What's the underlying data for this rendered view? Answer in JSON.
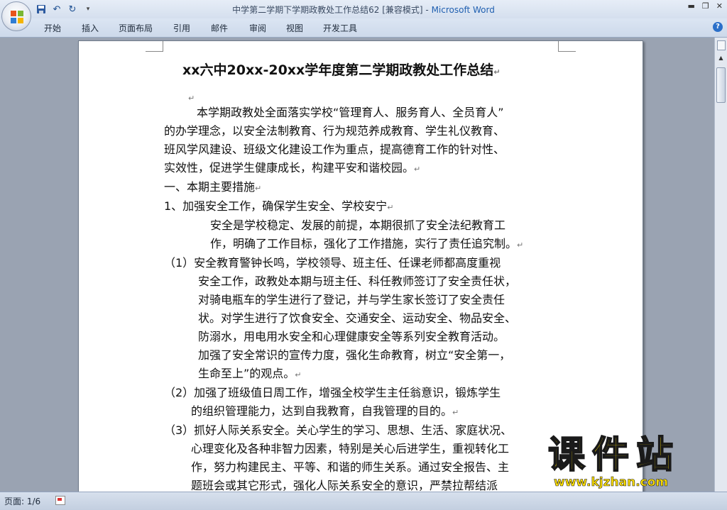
{
  "window": {
    "title": "中学第二学期下学期政教处工作总结62 [兼容模式]",
    "separator": " - ",
    "app_name": "Microsoft Word"
  },
  "ribbon_tabs": [
    "开始",
    "插入",
    "页面布局",
    "引用",
    "邮件",
    "审阅",
    "视图",
    "开发工具"
  ],
  "document": {
    "heading": "xx六中20xx-20xx学年度第二学期政教处工作总结",
    "lines": [
      "本学期政教处全面落实学校“管理育人、服务育人、全员育人”",
      "的办学理念，以安全法制教育、行为规范养成教育、学生礼仪教育、",
      "班风学风建设、班级文化建设工作为重点，提高德育工作的针对性、",
      "实效性，促进学生健康成长，构建平安和谐校园。",
      "一、本期主要措施",
      "1、加强安全工作，确保学生安全、学校安宁",
      "安全是学校稳定、发展的前提，本期很抓了安全法纪教育工",
      "作，明确了工作目标，强化了工作措施，实行了责任追究制。",
      "（1）安全教育警钟长鸣，学校领导、班主任、任课老师都高度重视",
      "安全工作，政教处本期与班主任、科任教师签订了安全责任状，",
      "对骑电瓶车的学生进行了登记，并与学生家长签订了安全责任",
      "状。对学生进行了饮食安全、交通安全、运动安全、物品安全、",
      "防溺水，用电用水安全和心理健康安全等系列安全教育活动。",
      "加强了安全常识的宣传力度，强化生命教育，树立“安全第一，",
      "生命至上”的观点。",
      "（2）加强了班级值日周工作，增强全校学生主任翁意识，锻炼学生",
      "的组织管理能力，达到自我教育，自我管理的目的。",
      "（3）抓好人际关系安全。关心学生的学习、思想、生活、家庭状况、",
      "心理变化及各种非智力因素，特别是关心后进学生，重视转化工",
      "作，努力构建民主、平等、和谐的师生关系。通过安全报告、主",
      "题班会或其它形式，强化人际关系安全的意识，严禁拉帮结派"
    ]
  },
  "status_bar": {
    "page": "页面: 1/6"
  },
  "watermark": {
    "text": "课件站",
    "url": "www.kjzhan.com"
  },
  "colors": {
    "title_app": "#1f5fb0",
    "watermark": "#ffe100"
  },
  "icons": [
    "office-button-icon",
    "save-icon",
    "undo-icon",
    "redo-icon",
    "customize-qat-icon",
    "minimize-icon",
    "restore-icon",
    "close-icon",
    "help-icon",
    "paragraph-mark-icon",
    "scroll-up-icon",
    "language-icon"
  ]
}
